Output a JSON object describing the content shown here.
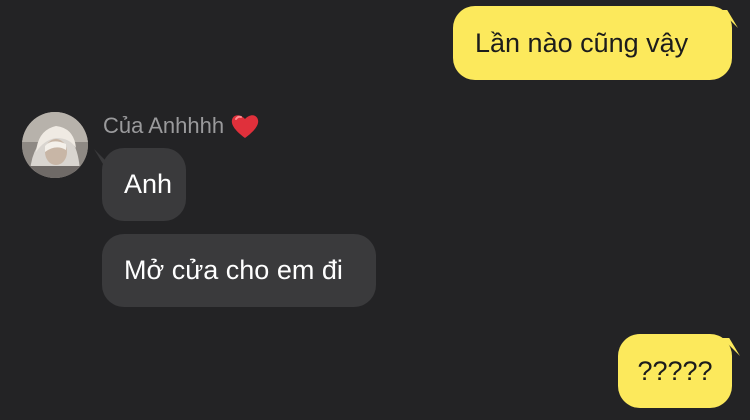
{
  "conversation": {
    "contact": {
      "name": "Của Anhhhh",
      "badge_icon": "red-heart-icon",
      "avatar_icon": "profile-avatar"
    },
    "messages": [
      {
        "id": "msg-1",
        "direction": "outgoing",
        "text": "Lần nào cũng vậy"
      },
      {
        "id": "msg-3",
        "direction": "incoming",
        "text": "Anh"
      },
      {
        "id": "msg-4",
        "direction": "incoming",
        "text": "Mở cửa cho em đi"
      },
      {
        "id": "msg-5",
        "direction": "outgoing",
        "text": "?????"
      }
    ]
  },
  "colors": {
    "background": "#232325",
    "outgoing_bubble": "#FCE95C",
    "incoming_bubble": "#3A3A3C",
    "sender_name": "#9A9A9C",
    "heart": "#E0303B"
  }
}
